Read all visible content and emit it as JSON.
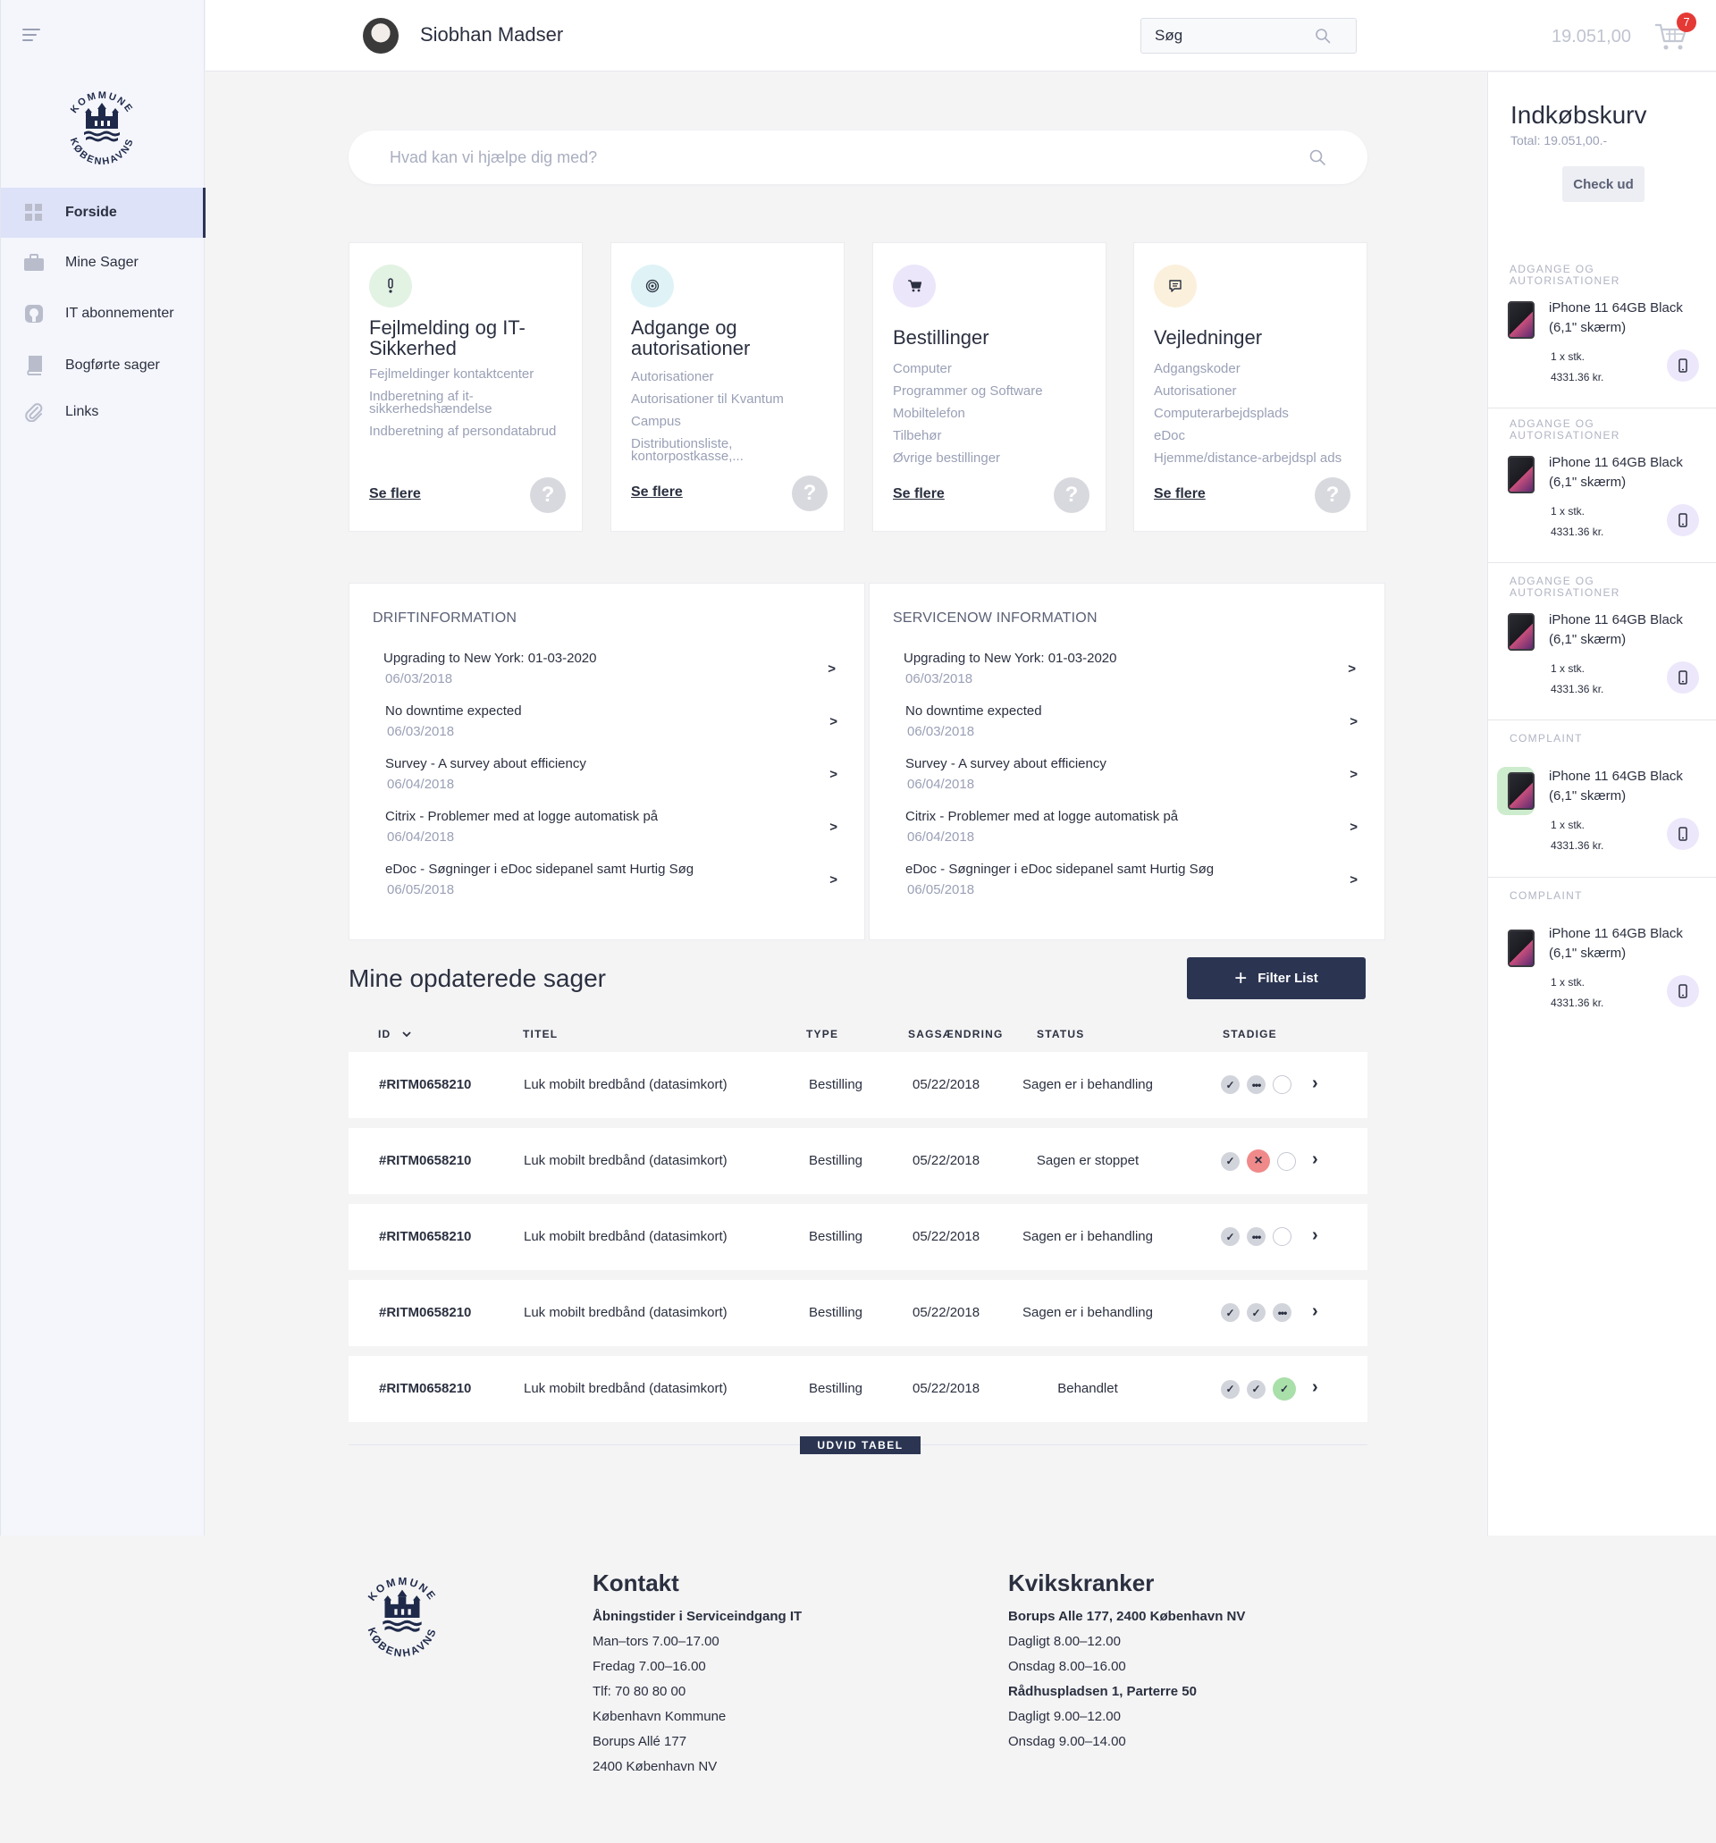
{
  "user": {
    "name": "Siobhan Madser"
  },
  "header": {
    "search_placeholder": "Søg",
    "cart_total": "19.051,00",
    "cart_count": "7"
  },
  "sidebar": {
    "items": [
      {
        "label": "Forside",
        "icon": "dashboard-icon"
      },
      {
        "label": "Mine Sager",
        "icon": "briefcase-icon"
      },
      {
        "label": "IT abonnementer",
        "icon": "subscription-icon"
      },
      {
        "label": "Bogførte sager",
        "icon": "book-icon"
      },
      {
        "label": "Links",
        "icon": "paperclip-icon"
      }
    ]
  },
  "logo": {
    "top_text": "KOMMUNE",
    "bottom_text": "KØBENHAVNS",
    "color": "#1f2a4a"
  },
  "main": {
    "help_search_placeholder": "Hvad kan vi hjælpe dig med?",
    "categories": [
      {
        "title": "Fejlmelding og IT-Sikkerhed",
        "icon": "exclamation-icon",
        "icon_bg": "#e2f2e3",
        "links": [
          "Fejlmeldinger kontaktcenter",
          "Indberetning af it-sikkerhedshændelse",
          "Indberetning af persondatabrud"
        ],
        "more": "Se flere"
      },
      {
        "title": "Adgange og autorisationer",
        "icon": "fingerprint-icon",
        "icon_bg": "#dff3f7",
        "links": [
          "Autorisationer",
          "Autorisationer til Kvantum",
          "Campus",
          "Distributionsliste, kontorpostkasse,..."
        ],
        "more": "Se flere"
      },
      {
        "title": "Bestillinger",
        "icon": "cart-icon",
        "icon_bg": "#ece6fb",
        "links": [
          "Computer",
          "Programmer og Software",
          "Mobiltelefon",
          "Tilbehør",
          "Øvrige bestillinger"
        ],
        "more": "Se flere"
      },
      {
        "title": "Vejledninger",
        "icon": "chat-icon",
        "icon_bg": "#fbf0dc",
        "links": [
          "Adgangskoder",
          "Autorisationer",
          "Computerarbejdsplads",
          "eDoc",
          "Hjemme/distance-arbejdspl ads"
        ],
        "more": "Se flere"
      }
    ],
    "help_glyph": "?",
    "info_panels": [
      {
        "heading": "DRIFTINFORMATION",
        "items": [
          {
            "title": "Upgrading to New York: 01-03-2020",
            "date": "06/03/2018"
          },
          {
            "title": "No downtime expected",
            "date": "06/03/2018"
          },
          {
            "title": "Survey - A survey about efficiency",
            "date": "06/04/2018"
          },
          {
            "title": "Citrix - Problemer med at logge automatisk på",
            "date": "06/04/2018"
          },
          {
            "title": "eDoc - Søgninger i eDoc sidepanel samt Hurtig Søg",
            "date": "06/05/2018"
          }
        ]
      },
      {
        "heading": "SERVICENOW INFORMATION",
        "items": [
          {
            "title": "Upgrading to New York: 01-03-2020",
            "date": "06/03/2018"
          },
          {
            "title": "No downtime expected",
            "date": "06/03/2018"
          },
          {
            "title": "Survey - A survey about efficiency",
            "date": "06/04/2018"
          },
          {
            "title": "Citrix - Problemer med at logge automatisk på",
            "date": "06/04/2018"
          },
          {
            "title": "eDoc - Søgninger i eDoc sidepanel samt Hurtig Søg",
            "date": "06/05/2018"
          }
        ]
      }
    ],
    "arrow": ">",
    "table": {
      "title": "Mine opdaterede sager",
      "filter_label": "Filter List",
      "columns": [
        "ID",
        "TITEL",
        "TYPE",
        "SAGSÆNDRING",
        "STATUS",
        "STADIGE"
      ],
      "rows": [
        {
          "id": "#RITM0658210",
          "title": "Luk mobilt bredbånd (datasimkort)",
          "type": "Bestilling",
          "date": "05/22/2018",
          "status": "Sagen er i behandling",
          "stages": [
            "done",
            "progress",
            "empty"
          ]
        },
        {
          "id": "#RITM0658210",
          "title": "Luk mobilt bredbånd (datasimkort)",
          "type": "Bestilling",
          "date": "05/22/2018",
          "status": "Sagen er stoppet",
          "stages": [
            "done",
            "stopped",
            "empty"
          ]
        },
        {
          "id": "#RITM0658210",
          "title": "Luk mobilt bredbånd (datasimkort)",
          "type": "Bestilling",
          "date": "05/22/2018",
          "status": "Sagen er i behandling",
          "stages": [
            "done",
            "progress",
            "empty"
          ]
        },
        {
          "id": "#RITM0658210",
          "title": "Luk mobilt bredbånd (datasimkort)",
          "type": "Bestilling",
          "date": "05/22/2018",
          "status": "Sagen er i behandling",
          "stages": [
            "done",
            "done",
            "progress"
          ]
        },
        {
          "id": "#RITM0658210",
          "title": "Luk mobilt bredbånd (datasimkort)",
          "type": "Bestilling",
          "date": "05/22/2018",
          "status": "Behandlet",
          "stages": [
            "done",
            "done",
            "completed"
          ]
        }
      ],
      "expand_label": "UDVID TABEL"
    }
  },
  "cart": {
    "title": "Indkøbskurv",
    "total": "Total: 19.051,00.-",
    "checkout_label": "Check ud",
    "items": [
      {
        "category": "ADGANGE OG AUTORISATIONER",
        "name": "iPhone 11 64GB Black (6,1\" skærm)",
        "qty": "1 x stk.",
        "price": "4331.36 kr."
      },
      {
        "category": "ADGANGE OG AUTORISATIONER",
        "name": "iPhone 11 64GB Black (6,1\" skærm)",
        "qty": "1 x stk.",
        "price": "4331.36 kr."
      },
      {
        "category": "ADGANGE OG AUTORISATIONER",
        "name": "iPhone 11 64GB Black (6,1\" skærm)",
        "qty": "1 x stk.",
        "price": "4331.36 kr."
      },
      {
        "category": "COMPLAINT",
        "name": "iPhone 11 64GB Black (6,1\" skærm)",
        "qty": "1 x stk.",
        "price": "4331.36 kr."
      },
      {
        "category": "COMPLAINT",
        "name": "iPhone 11 64GB Black (6,1\" skærm)",
        "qty": "1 x stk.",
        "price": "4331.36 kr."
      }
    ]
  },
  "footer": {
    "contact": {
      "heading": "Kontakt",
      "lines": [
        {
          "text": "Åbningstider i Serviceindgang IT",
          "bold": true
        },
        {
          "text": "Man–tors 7.00–17.00"
        },
        {
          "text": "Fredag 7.00–16.00"
        },
        {
          "text": "Tlf: 70 80 80 00"
        },
        {
          "text": "København Kommune"
        },
        {
          "text": "Borups Allé 177"
        },
        {
          "text": "2400 København NV"
        }
      ]
    },
    "kiosks": {
      "heading": "Kvikskranker",
      "lines": [
        {
          "text": "Borups Alle 177, 2400 København NV",
          "bold": true
        },
        {
          "text": "Dagligt 8.00–12.00"
        },
        {
          "text": "Onsdag 8.00–16.00"
        },
        {
          "text": "Rådhuspladsen 1, Parterre 50",
          "bold": true
        },
        {
          "text": "Dagligt 9.00–12.00"
        },
        {
          "text": "Onsdag 9.00–14.00"
        }
      ]
    }
  },
  "colors": {
    "primary": "#2b3552",
    "muted_text": "#9aa0b6",
    "badge": "#e53935",
    "stage_stopped": "#f08a8a",
    "stage_completed": "#a9dfa9"
  }
}
